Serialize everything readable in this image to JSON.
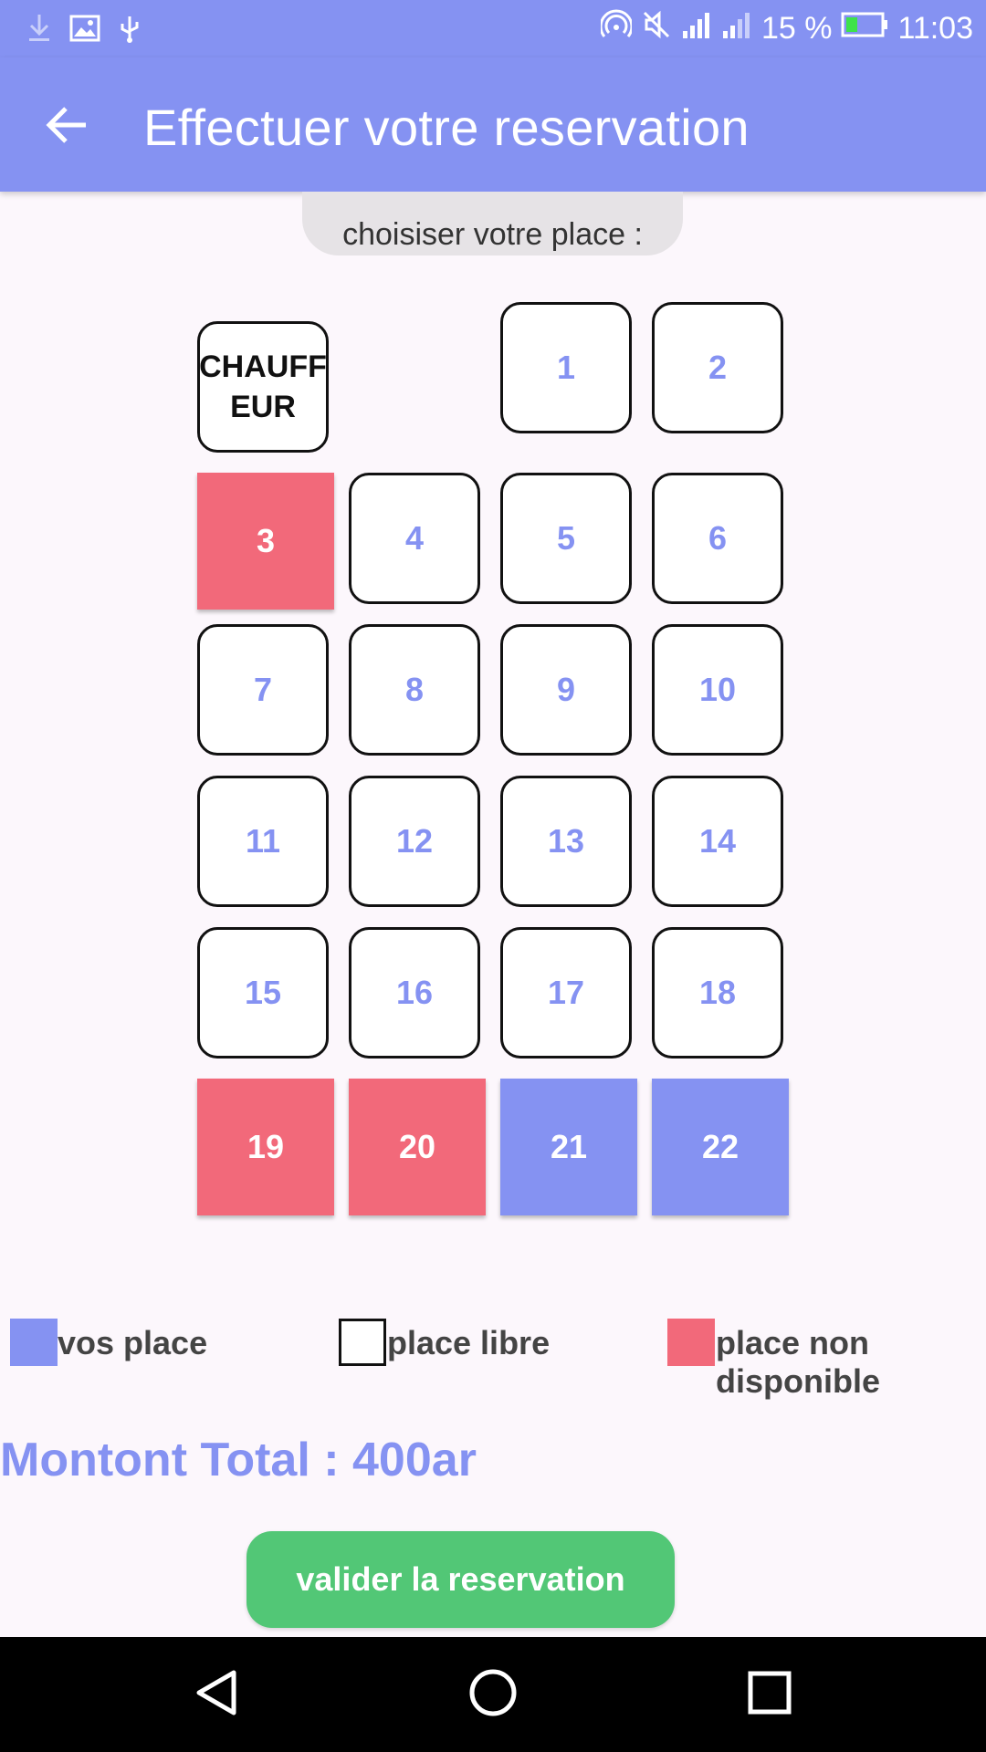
{
  "status_bar": {
    "signal_text": "15 %",
    "time": "11:03",
    "icons": [
      "download-icon",
      "image-icon",
      "usb-icon",
      "hotspot-icon",
      "mute-icon",
      "signal-icon",
      "signal-icon",
      "battery-icon"
    ]
  },
  "app_bar": {
    "title": "Effectuer votre reservation",
    "back_icon": "back-arrow-icon"
  },
  "choose_label": "choisiser votre place :",
  "seats": {
    "driver_label": "CHAUFF EUR",
    "s1": "1",
    "s2": "2",
    "s3": "3",
    "s4": "4",
    "s5": "5",
    "s6": "6",
    "s7": "7",
    "s8": "8",
    "s9": "9",
    "s10": "10",
    "s11": "11",
    "s12": "12",
    "s13": "13",
    "s14": "14",
    "s15": "15",
    "s16": "16",
    "s17": "17",
    "s18": "18",
    "s19": "19",
    "s20": "20",
    "s21": "21",
    "s22": "22",
    "taken": [
      "3",
      "19",
      "20"
    ],
    "mine": [
      "21",
      "22"
    ]
  },
  "legend": {
    "mine": "vos place",
    "free": "place libre",
    "taken_line1": "place non",
    "taken_line2": "disponible"
  },
  "total": "Montont Total : 400ar",
  "validate_button": "valider la reservation",
  "colors": {
    "accent": "#8592f2",
    "taken": "#f2697a",
    "validate": "#52c776",
    "background": "#fcf7fc"
  },
  "nav_bar": {
    "icons": [
      "nav-back-icon",
      "nav-home-icon",
      "nav-recents-icon"
    ]
  }
}
